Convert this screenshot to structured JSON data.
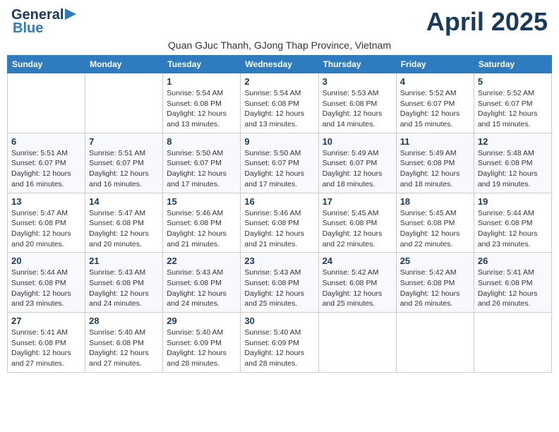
{
  "header": {
    "logo_line1": "General",
    "logo_line2": "Blue",
    "month_title": "April 2025",
    "subtitle": "Quan GJuc Thanh, GJong Thap Province, Vietnam"
  },
  "days_of_week": [
    "Sunday",
    "Monday",
    "Tuesday",
    "Wednesday",
    "Thursday",
    "Friday",
    "Saturday"
  ],
  "weeks": [
    [
      {
        "day": "",
        "info": ""
      },
      {
        "day": "",
        "info": ""
      },
      {
        "day": "1",
        "info": "Sunrise: 5:54 AM\nSunset: 6:08 PM\nDaylight: 12 hours\nand 13 minutes."
      },
      {
        "day": "2",
        "info": "Sunrise: 5:54 AM\nSunset: 6:08 PM\nDaylight: 12 hours\nand 13 minutes."
      },
      {
        "day": "3",
        "info": "Sunrise: 5:53 AM\nSunset: 6:08 PM\nDaylight: 12 hours\nand 14 minutes."
      },
      {
        "day": "4",
        "info": "Sunrise: 5:52 AM\nSunset: 6:07 PM\nDaylight: 12 hours\nand 15 minutes."
      },
      {
        "day": "5",
        "info": "Sunrise: 5:52 AM\nSunset: 6:07 PM\nDaylight: 12 hours\nand 15 minutes."
      }
    ],
    [
      {
        "day": "6",
        "info": "Sunrise: 5:51 AM\nSunset: 6:07 PM\nDaylight: 12 hours\nand 16 minutes."
      },
      {
        "day": "7",
        "info": "Sunrise: 5:51 AM\nSunset: 6:07 PM\nDaylight: 12 hours\nand 16 minutes."
      },
      {
        "day": "8",
        "info": "Sunrise: 5:50 AM\nSunset: 6:07 PM\nDaylight: 12 hours\nand 17 minutes."
      },
      {
        "day": "9",
        "info": "Sunrise: 5:50 AM\nSunset: 6:07 PM\nDaylight: 12 hours\nand 17 minutes."
      },
      {
        "day": "10",
        "info": "Sunrise: 5:49 AM\nSunset: 6:07 PM\nDaylight: 12 hours\nand 18 minutes."
      },
      {
        "day": "11",
        "info": "Sunrise: 5:49 AM\nSunset: 6:08 PM\nDaylight: 12 hours\nand 18 minutes."
      },
      {
        "day": "12",
        "info": "Sunrise: 5:48 AM\nSunset: 6:08 PM\nDaylight: 12 hours\nand 19 minutes."
      }
    ],
    [
      {
        "day": "13",
        "info": "Sunrise: 5:47 AM\nSunset: 6:08 PM\nDaylight: 12 hours\nand 20 minutes."
      },
      {
        "day": "14",
        "info": "Sunrise: 5:47 AM\nSunset: 6:08 PM\nDaylight: 12 hours\nand 20 minutes."
      },
      {
        "day": "15",
        "info": "Sunrise: 5:46 AM\nSunset: 6:08 PM\nDaylight: 12 hours\nand 21 minutes."
      },
      {
        "day": "16",
        "info": "Sunrise: 5:46 AM\nSunset: 6:08 PM\nDaylight: 12 hours\nand 21 minutes."
      },
      {
        "day": "17",
        "info": "Sunrise: 5:45 AM\nSunset: 6:08 PM\nDaylight: 12 hours\nand 22 minutes."
      },
      {
        "day": "18",
        "info": "Sunrise: 5:45 AM\nSunset: 6:08 PM\nDaylight: 12 hours\nand 22 minutes."
      },
      {
        "day": "19",
        "info": "Sunrise: 5:44 AM\nSunset: 6:08 PM\nDaylight: 12 hours\nand 23 minutes."
      }
    ],
    [
      {
        "day": "20",
        "info": "Sunrise: 5:44 AM\nSunset: 6:08 PM\nDaylight: 12 hours\nand 23 minutes."
      },
      {
        "day": "21",
        "info": "Sunrise: 5:43 AM\nSunset: 6:08 PM\nDaylight: 12 hours\nand 24 minutes."
      },
      {
        "day": "22",
        "info": "Sunrise: 5:43 AM\nSunset: 6:08 PM\nDaylight: 12 hours\nand 24 minutes."
      },
      {
        "day": "23",
        "info": "Sunrise: 5:43 AM\nSunset: 6:08 PM\nDaylight: 12 hours\nand 25 minutes."
      },
      {
        "day": "24",
        "info": "Sunrise: 5:42 AM\nSunset: 6:08 PM\nDaylight: 12 hours\nand 25 minutes."
      },
      {
        "day": "25",
        "info": "Sunrise: 5:42 AM\nSunset: 6:08 PM\nDaylight: 12 hours\nand 26 minutes."
      },
      {
        "day": "26",
        "info": "Sunrise: 5:41 AM\nSunset: 6:08 PM\nDaylight: 12 hours\nand 26 minutes."
      }
    ],
    [
      {
        "day": "27",
        "info": "Sunrise: 5:41 AM\nSunset: 6:08 PM\nDaylight: 12 hours\nand 27 minutes."
      },
      {
        "day": "28",
        "info": "Sunrise: 5:40 AM\nSunset: 6:08 PM\nDaylight: 12 hours\nand 27 minutes."
      },
      {
        "day": "29",
        "info": "Sunrise: 5:40 AM\nSunset: 6:09 PM\nDaylight: 12 hours\nand 28 minutes."
      },
      {
        "day": "30",
        "info": "Sunrise: 5:40 AM\nSunset: 6:09 PM\nDaylight: 12 hours\nand 28 minutes."
      },
      {
        "day": "",
        "info": ""
      },
      {
        "day": "",
        "info": ""
      },
      {
        "day": "",
        "info": ""
      }
    ]
  ]
}
